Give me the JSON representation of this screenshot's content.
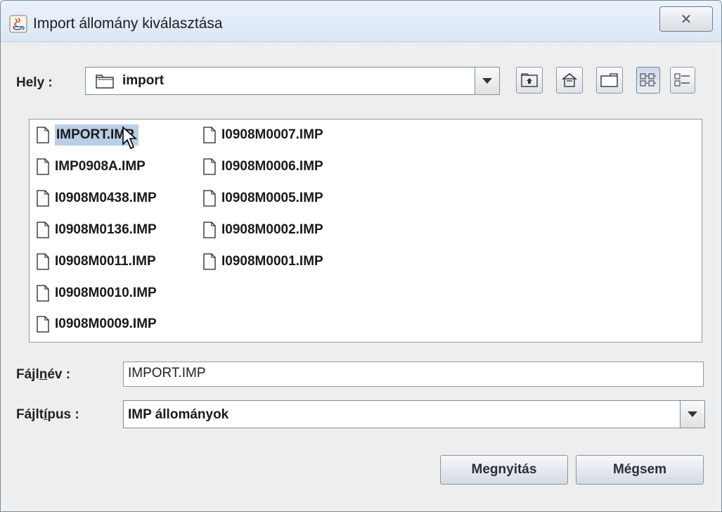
{
  "window": {
    "title": "Import állomány kiválasztása",
    "close_icon_name": "close-icon",
    "app_icon_name": "java-icon"
  },
  "location": {
    "label": "Hely :",
    "value": "import",
    "folder_icon": "folder-icon"
  },
  "toolbar": {
    "buttons": [
      {
        "name": "up-one-level-icon"
      },
      {
        "name": "home-icon"
      },
      {
        "name": "new-folder-icon"
      },
      {
        "name": "list-view-icon"
      },
      {
        "name": "details-view-icon"
      }
    ]
  },
  "files": [
    {
      "name": "IMPORT.IMP",
      "selected": true
    },
    {
      "name": "IMP0908A.IMP"
    },
    {
      "name": "I0908M0438.IMP"
    },
    {
      "name": "I0908M0136.IMP"
    },
    {
      "name": "I0908M0011.IMP"
    },
    {
      "name": "I0908M0010.IMP"
    },
    {
      "name": "I0908M0009.IMP"
    },
    {
      "name": "I0908M0007.IMP"
    },
    {
      "name": "I0908M0006.IMP"
    },
    {
      "name": "I0908M0005.IMP"
    },
    {
      "name": "I0908M0002.IMP"
    },
    {
      "name": "I0908M0001.IMP"
    }
  ],
  "filename": {
    "label_pre": "Fájl",
    "label_mnemonic": "n",
    "label_post": "év :",
    "value": "IMPORT.IMP"
  },
  "filetype": {
    "label_pre": "Fájlt",
    "label_mnemonic": "í",
    "label_post": "pus :",
    "value": "IMP állományok"
  },
  "buttons": {
    "open": "Megnyitás",
    "cancel": "Mégsem"
  }
}
